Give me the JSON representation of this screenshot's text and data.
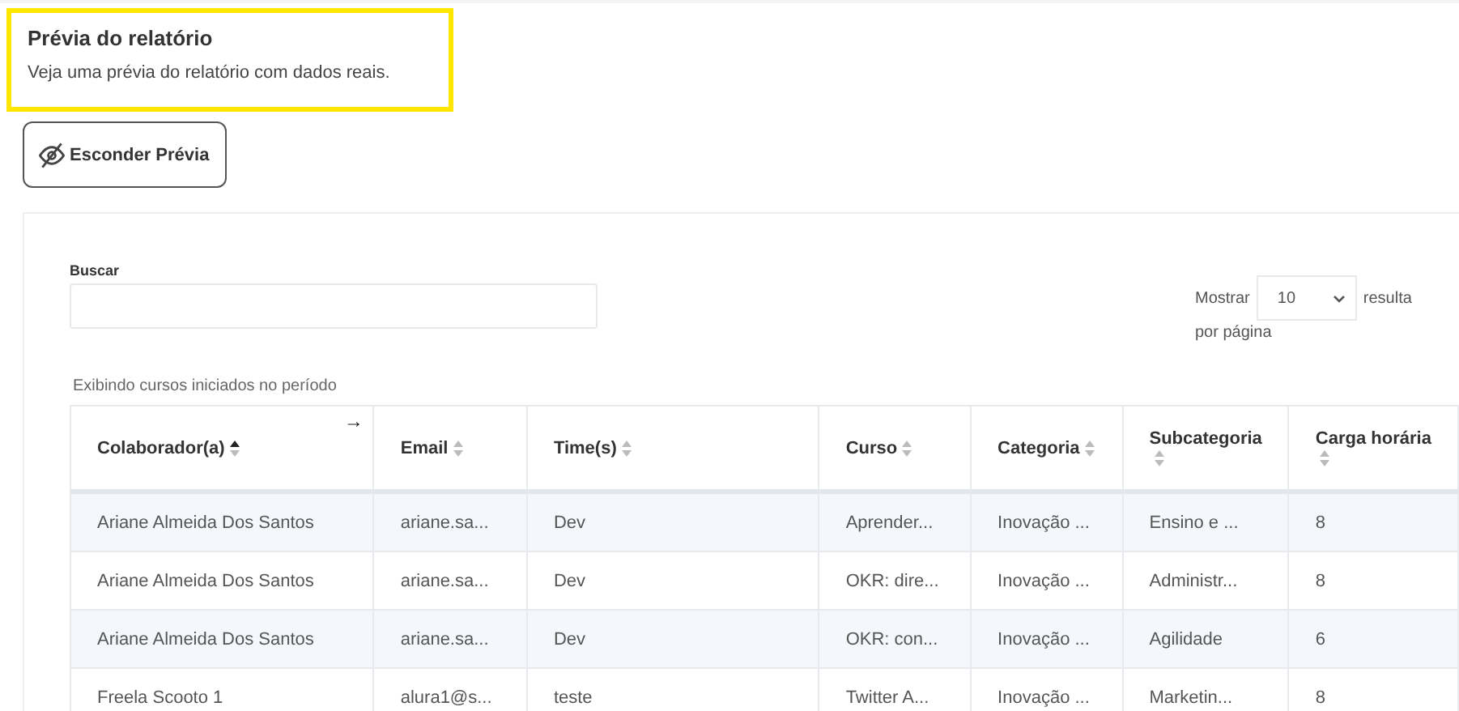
{
  "header": {
    "title": "Prévia do relatório",
    "subtitle": "Veja uma prévia do relatório com dados reais.",
    "highlighted": true
  },
  "toggle_button": {
    "label": "Esconder Prévia"
  },
  "search": {
    "label": "Buscar"
  },
  "page_size": {
    "prefix": "Mostrar",
    "value": "10",
    "suffix": "resulta",
    "suffix_line2": "por página"
  },
  "caption": "Exibindo cursos iniciados no período",
  "table": {
    "scroll_hint": "→",
    "columns": [
      {
        "label": "Colaborador(a)",
        "sorted": true
      },
      {
        "label": "Email",
        "sorted": false
      },
      {
        "label": "Time(s)",
        "sorted": false
      },
      {
        "label": "Curso",
        "sorted": false
      },
      {
        "label": "Categoria",
        "sorted": false
      },
      {
        "label": "Subcategoria",
        "sorted": false
      },
      {
        "label": "Carga horária",
        "sorted": false
      }
    ],
    "rows": [
      [
        "Ariane Almeida Dos Santos",
        "ariane.sa...",
        "Dev",
        "Aprender...",
        "Inovação ...",
        "Ensino e ...",
        "8"
      ],
      [
        "Ariane Almeida Dos Santos",
        "ariane.sa...",
        "Dev",
        "OKR: dire...",
        "Inovação ...",
        "Administr...",
        "8"
      ],
      [
        "Ariane Almeida Dos Santos",
        "ariane.sa...",
        "Dev",
        "OKR: con...",
        "Inovação ...",
        "Agilidade",
        "6"
      ],
      [
        "Freela Scooto 1",
        "alura1@s...",
        "teste",
        "Twitter A...",
        "Inovação ...",
        "Marketin...",
        "8"
      ]
    ]
  }
}
